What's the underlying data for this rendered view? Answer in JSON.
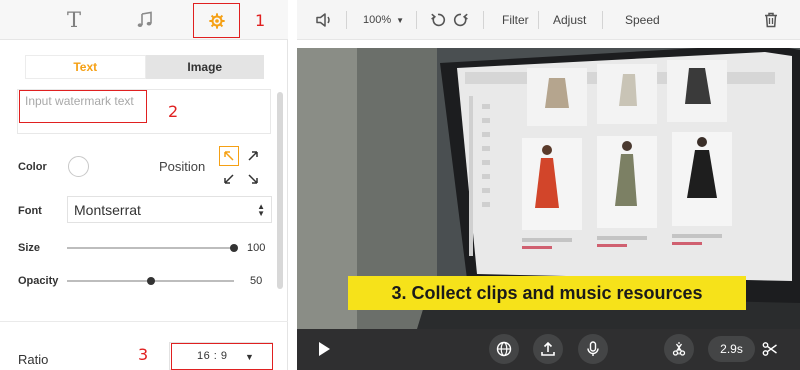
{
  "left_panel": {
    "annotations": {
      "a1": "1",
      "a2": "2",
      "a3": "3"
    },
    "segmented": {
      "text_label": "Text",
      "image_label": "Image",
      "active": "Text"
    },
    "watermark": {
      "placeholder": "Input watermark text",
      "value": ""
    },
    "color_label": "Color",
    "color_value": "#ffffff",
    "position_label": "Position",
    "position_selected": "top-left",
    "font_label": "Font",
    "font_value": "Montserrat",
    "size_label": "Size",
    "size_value": "100",
    "size_max": 100,
    "opacity_label": "Opacity",
    "opacity_value": "50",
    "opacity_max": 100,
    "ratio_label": "Ratio",
    "ratio_value": "16 : 9"
  },
  "toolbar": {
    "zoom": "100%",
    "filter_label": "Filter",
    "adjust_label": "Adjust",
    "speed_label": "Speed"
  },
  "video": {
    "caption": "3. Collect clips and music resources"
  },
  "controls": {
    "duration": "2.9s"
  },
  "colors": {
    "accent": "#f5a014",
    "annotation_red": "#e02020",
    "caption_bg": "#f6e21a",
    "control_bar": "#2f2f30"
  },
  "icons": [
    "text-icon",
    "music-icon",
    "gear-icon",
    "speaker-icon",
    "undo-icon",
    "redo-icon",
    "trash-icon",
    "play-icon",
    "globe-icon",
    "upload-icon",
    "mic-icon",
    "split-icon",
    "scissors-icon"
  ]
}
